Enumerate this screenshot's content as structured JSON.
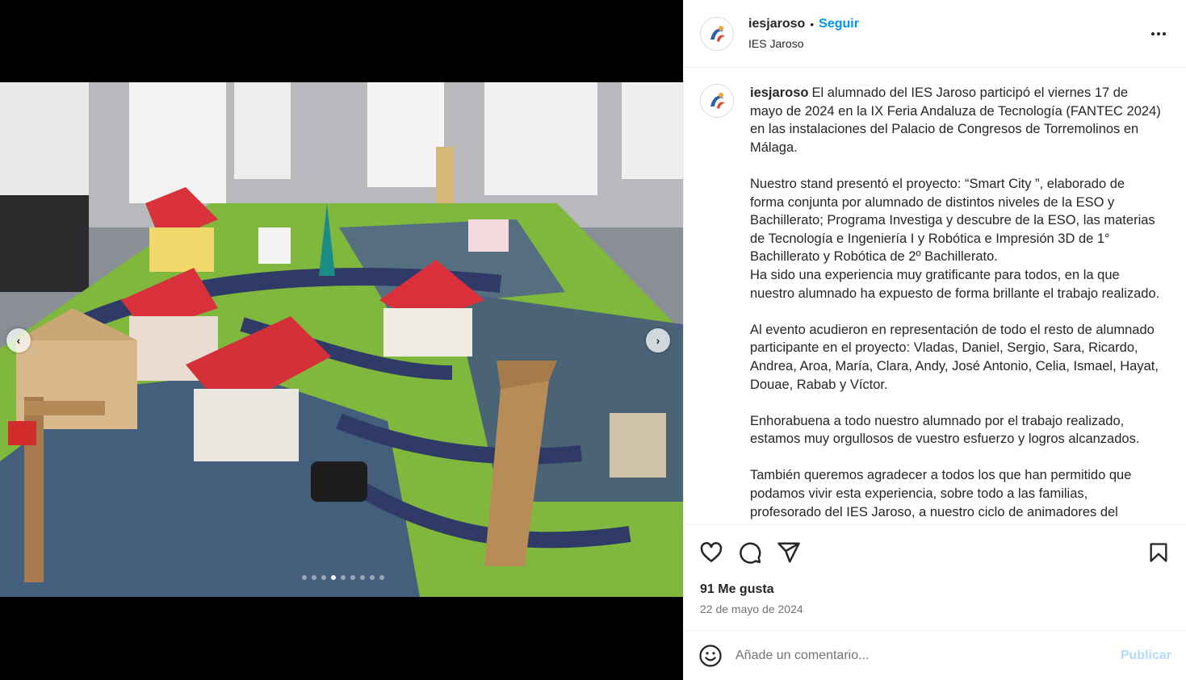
{
  "post": {
    "account": {
      "username": "iesjaroso",
      "separator": "•",
      "follow_label": "Seguir",
      "display_name": "IES Jaroso"
    },
    "caption": {
      "username": "iesjaroso",
      "p1": "El alumnado del IES Jaroso participó el viernes 17 de mayo de 2024 en la IX Feria Andaluza de Tecnología (FANTEC 2024) en las instalaciones del Palacio de Congresos de Torremolinos en Málaga.",
      "p2": "Nuestro stand presentó el proyecto: “Smart City ”, elaborado de forma conjunta por alumnado de distintos niveles de la ESO y Bachillerato; Programa Investiga y descubre de la ESO, las materias de Tecnología e Ingeniería I y Robótica e Impresión 3D de 1° Bachillerato y Robótica de 2º Bachillerato.\nHa sido una experiencia muy gratificante para todos, en la que nuestro alumnado ha expuesto de forma brillante el trabajo realizado.",
      "p3": "Al evento acudieron en representación de todo el resto de alumnado participante en el proyecto: Vladas, Daniel, Sergio, Sara, Ricardo, Andrea, Aroa, María, Clara, Andy, José Antonio, Celia, Ismael, Hayat, Douae, Rabab y Víctor.",
      "p4": "Enhorabuena a todo nuestro alumnado por el trabajo realizado, estamos muy orgullosos de vuestro esfuerzo y logros alcanzados.",
      "p5": "También queremos agradecer a todos los que han permitido que podamos vivir esta experiencia, sobre todo a las familias, profesorado del IES Jaroso, a nuestro ciclo de animadores del"
    },
    "likes": "91 Me gusta",
    "date": "22 de mayo de 2024",
    "comment": {
      "placeholder": "Añade un comentario...",
      "publish_label": "Publicar"
    },
    "carousel": {
      "total": 9,
      "active_index": 3
    },
    "icons": {
      "like": "heart-icon",
      "comment": "comment-icon",
      "share": "share-icon",
      "save": "bookmark-icon",
      "more": "more-icon",
      "emoji": "emoji-icon"
    },
    "colors": {
      "follow": "#0095f6",
      "publish_disabled": "#b3dbff",
      "text": "#262626",
      "muted": "#737373"
    }
  }
}
